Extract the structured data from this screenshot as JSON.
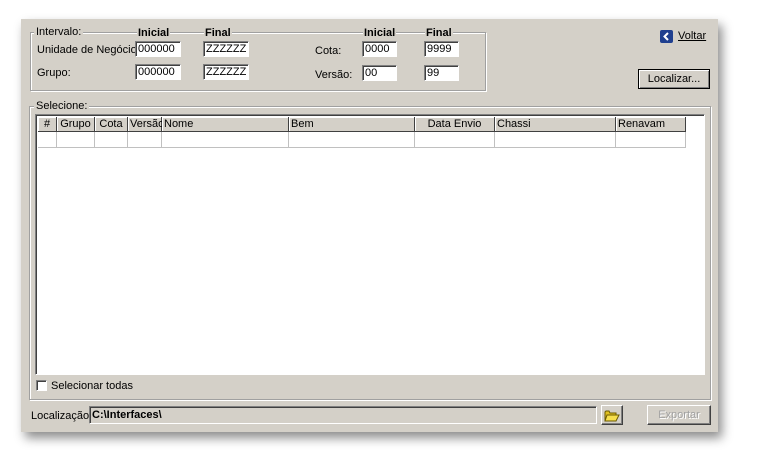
{
  "intervalo": {
    "legend": "Intervalo:",
    "col_inicial": "Inicial",
    "col_final": "Final",
    "unidade_label": "Unidade de Negócio:",
    "unidade_inicial": "000000",
    "unidade_final": "ZZZZZZ",
    "grupo_label": "Grupo:",
    "grupo_inicial": "000000",
    "grupo_final": "ZZZZZZ",
    "cota_label": "Cota:",
    "cota_inicial": "0000",
    "cota_final": "9999",
    "versao_label": "Versão:",
    "versao_inicial": "00",
    "versao_final": "99"
  },
  "voltar": {
    "label": "Voltar",
    "icon": "back-arrow-icon",
    "icon_color": "#1f3f8f"
  },
  "localizar_button": "Localizar...",
  "selecione": {
    "legend": "Selecione:",
    "columns": [
      "#",
      "Grupo",
      "Cota",
      "Versão",
      "Nome",
      "Bem",
      "Data Envio",
      "Chassi",
      "Renavam"
    ]
  },
  "selecionar_todas": "Selecionar todas",
  "localizacao": {
    "label": "Localização:",
    "value": "C:\\Interfaces\\"
  },
  "folder_icon": "folder-open-icon",
  "exportar_button": "Exportar"
}
